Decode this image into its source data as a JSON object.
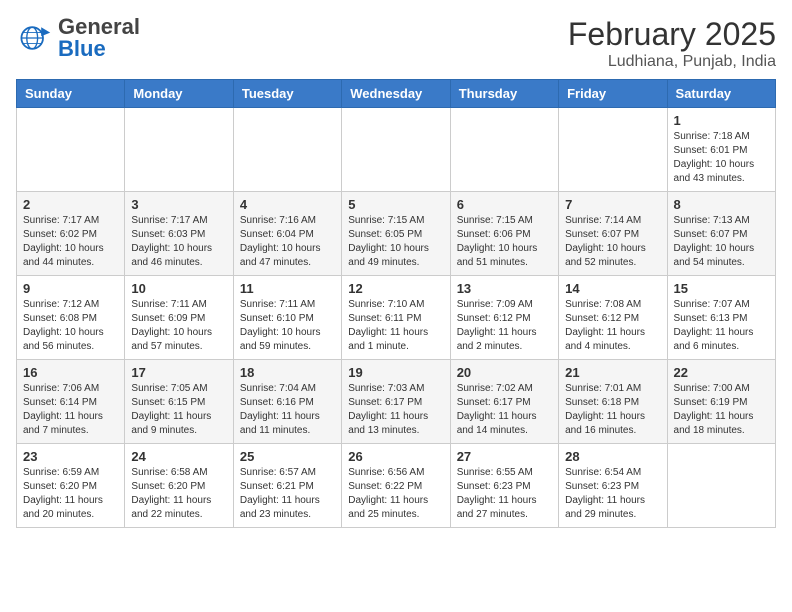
{
  "header": {
    "logo": {
      "general": "General",
      "blue": "Blue"
    },
    "month_year": "February 2025",
    "location": "Ludhiana, Punjab, India"
  },
  "days_of_week": [
    "Sunday",
    "Monday",
    "Tuesday",
    "Wednesday",
    "Thursday",
    "Friday",
    "Saturday"
  ],
  "weeks": [
    [
      {
        "day": "",
        "info": ""
      },
      {
        "day": "",
        "info": ""
      },
      {
        "day": "",
        "info": ""
      },
      {
        "day": "",
        "info": ""
      },
      {
        "day": "",
        "info": ""
      },
      {
        "day": "",
        "info": ""
      },
      {
        "day": "1",
        "info": "Sunrise: 7:18 AM\nSunset: 6:01 PM\nDaylight: 10 hours\nand 43 minutes."
      }
    ],
    [
      {
        "day": "2",
        "info": "Sunrise: 7:17 AM\nSunset: 6:02 PM\nDaylight: 10 hours\nand 44 minutes."
      },
      {
        "day": "3",
        "info": "Sunrise: 7:17 AM\nSunset: 6:03 PM\nDaylight: 10 hours\nand 46 minutes."
      },
      {
        "day": "4",
        "info": "Sunrise: 7:16 AM\nSunset: 6:04 PM\nDaylight: 10 hours\nand 47 minutes."
      },
      {
        "day": "5",
        "info": "Sunrise: 7:15 AM\nSunset: 6:05 PM\nDaylight: 10 hours\nand 49 minutes."
      },
      {
        "day": "6",
        "info": "Sunrise: 7:15 AM\nSunset: 6:06 PM\nDaylight: 10 hours\nand 51 minutes."
      },
      {
        "day": "7",
        "info": "Sunrise: 7:14 AM\nSunset: 6:07 PM\nDaylight: 10 hours\nand 52 minutes."
      },
      {
        "day": "8",
        "info": "Sunrise: 7:13 AM\nSunset: 6:07 PM\nDaylight: 10 hours\nand 54 minutes."
      }
    ],
    [
      {
        "day": "9",
        "info": "Sunrise: 7:12 AM\nSunset: 6:08 PM\nDaylight: 10 hours\nand 56 minutes."
      },
      {
        "day": "10",
        "info": "Sunrise: 7:11 AM\nSunset: 6:09 PM\nDaylight: 10 hours\nand 57 minutes."
      },
      {
        "day": "11",
        "info": "Sunrise: 7:11 AM\nSunset: 6:10 PM\nDaylight: 10 hours\nand 59 minutes."
      },
      {
        "day": "12",
        "info": "Sunrise: 7:10 AM\nSunset: 6:11 PM\nDaylight: 11 hours\nand 1 minute."
      },
      {
        "day": "13",
        "info": "Sunrise: 7:09 AM\nSunset: 6:12 PM\nDaylight: 11 hours\nand 2 minutes."
      },
      {
        "day": "14",
        "info": "Sunrise: 7:08 AM\nSunset: 6:12 PM\nDaylight: 11 hours\nand 4 minutes."
      },
      {
        "day": "15",
        "info": "Sunrise: 7:07 AM\nSunset: 6:13 PM\nDaylight: 11 hours\nand 6 minutes."
      }
    ],
    [
      {
        "day": "16",
        "info": "Sunrise: 7:06 AM\nSunset: 6:14 PM\nDaylight: 11 hours\nand 7 minutes."
      },
      {
        "day": "17",
        "info": "Sunrise: 7:05 AM\nSunset: 6:15 PM\nDaylight: 11 hours\nand 9 minutes."
      },
      {
        "day": "18",
        "info": "Sunrise: 7:04 AM\nSunset: 6:16 PM\nDaylight: 11 hours\nand 11 minutes."
      },
      {
        "day": "19",
        "info": "Sunrise: 7:03 AM\nSunset: 6:17 PM\nDaylight: 11 hours\nand 13 minutes."
      },
      {
        "day": "20",
        "info": "Sunrise: 7:02 AM\nSunset: 6:17 PM\nDaylight: 11 hours\nand 14 minutes."
      },
      {
        "day": "21",
        "info": "Sunrise: 7:01 AM\nSunset: 6:18 PM\nDaylight: 11 hours\nand 16 minutes."
      },
      {
        "day": "22",
        "info": "Sunrise: 7:00 AM\nSunset: 6:19 PM\nDaylight: 11 hours\nand 18 minutes."
      }
    ],
    [
      {
        "day": "23",
        "info": "Sunrise: 6:59 AM\nSunset: 6:20 PM\nDaylight: 11 hours\nand 20 minutes."
      },
      {
        "day": "24",
        "info": "Sunrise: 6:58 AM\nSunset: 6:20 PM\nDaylight: 11 hours\nand 22 minutes."
      },
      {
        "day": "25",
        "info": "Sunrise: 6:57 AM\nSunset: 6:21 PM\nDaylight: 11 hours\nand 23 minutes."
      },
      {
        "day": "26",
        "info": "Sunrise: 6:56 AM\nSunset: 6:22 PM\nDaylight: 11 hours\nand 25 minutes."
      },
      {
        "day": "27",
        "info": "Sunrise: 6:55 AM\nSunset: 6:23 PM\nDaylight: 11 hours\nand 27 minutes."
      },
      {
        "day": "28",
        "info": "Sunrise: 6:54 AM\nSunset: 6:23 PM\nDaylight: 11 hours\nand 29 minutes."
      },
      {
        "day": "",
        "info": ""
      }
    ]
  ]
}
